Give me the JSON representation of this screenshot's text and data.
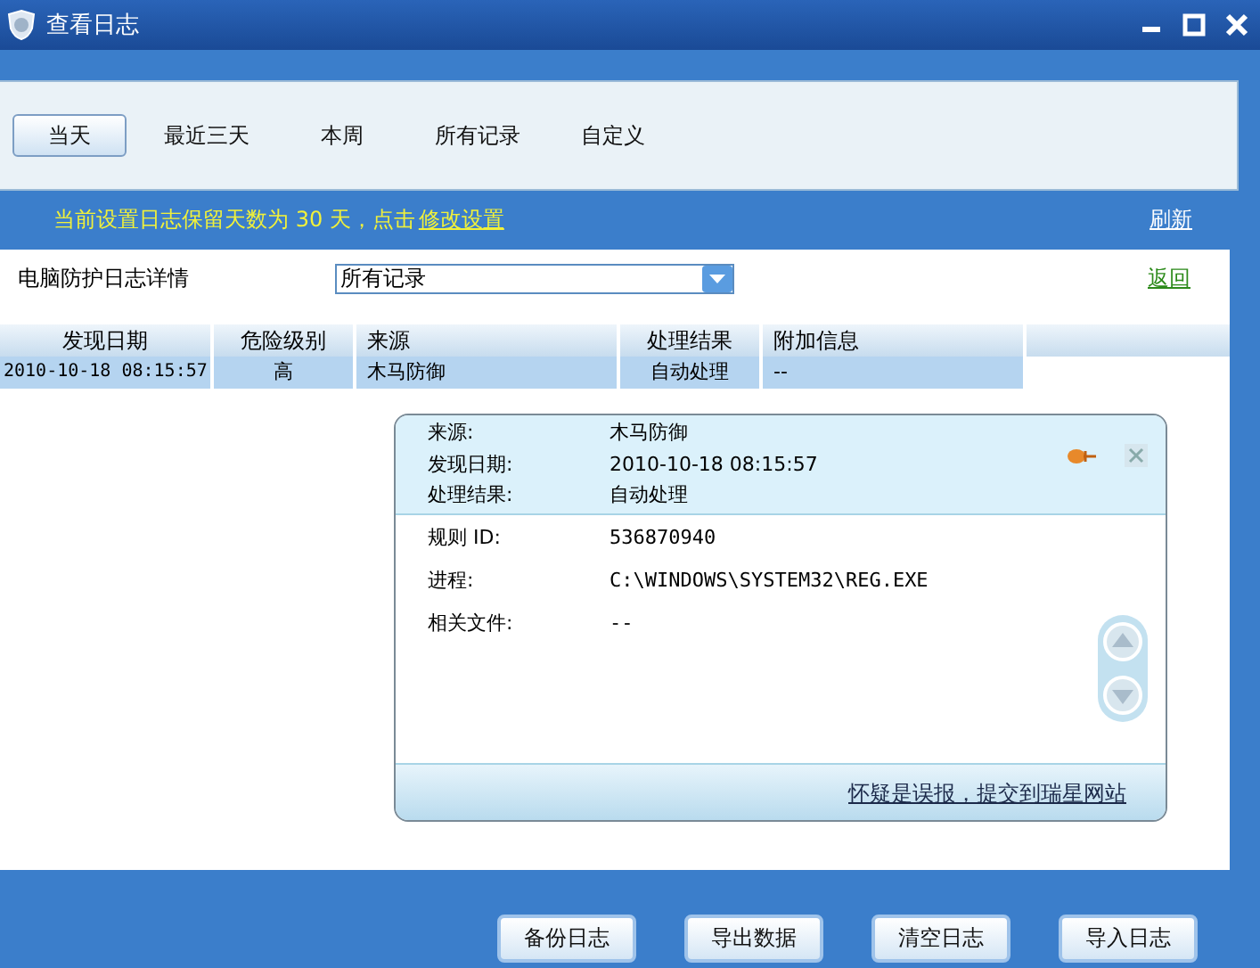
{
  "window": {
    "title": "查看日志"
  },
  "tabs": [
    {
      "label": "当天",
      "selected": true
    },
    {
      "label": "最近三天",
      "selected": false
    },
    {
      "label": "本周",
      "selected": false
    },
    {
      "label": "所有记录",
      "selected": false
    },
    {
      "label": "自定义",
      "selected": false
    }
  ],
  "notice": {
    "text": "当前设置日志保留天数为 30 天，点击",
    "link": "修改设置"
  },
  "refresh": "刷新",
  "section_title": "电脑防护日志详情",
  "filter": {
    "value": "所有记录"
  },
  "back": "返回",
  "table": {
    "columns": [
      "发现日期",
      "危险级别",
      "来源",
      "处理结果",
      "附加信息"
    ],
    "rows": [
      {
        "cells": [
          "2010-10-18 08:15:57",
          "高",
          "木马防御",
          "自动处理",
          "--"
        ],
        "selected": true
      }
    ]
  },
  "detail": {
    "header": [
      {
        "label": "来源:",
        "value": "木马防御"
      },
      {
        "label": "发现日期:",
        "value": "2010-10-18 08:15:57"
      },
      {
        "label": "处理结果:",
        "value": "自动处理"
      }
    ],
    "body": [
      {
        "label": "规则 ID:",
        "value": "536870940"
      },
      {
        "label": "进程:",
        "value": "C:\\WINDOWS\\SYSTEM32\\REG.EXE"
      },
      {
        "label": "相关文件:",
        "value": "--"
      }
    ],
    "link": "怀疑是误报，提交到瑞星网站"
  },
  "buttons": [
    "备份日志",
    "导出数据",
    "清空日志",
    "导入日志"
  ]
}
